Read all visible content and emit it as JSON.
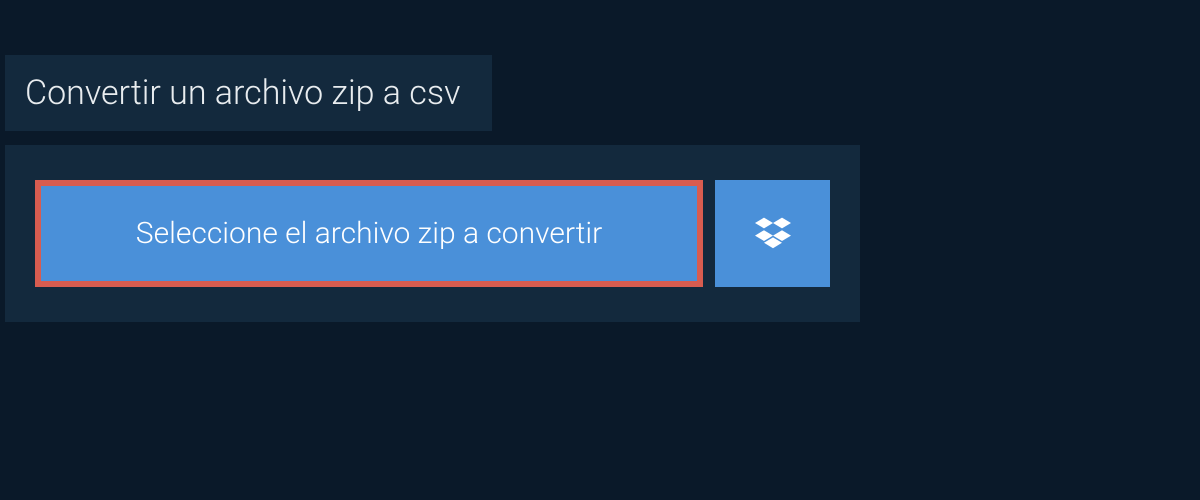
{
  "title": "Convertir un archivo zip a csv",
  "selectButton": {
    "label": "Seleccione el archivo zip a convertir"
  },
  "colors": {
    "background": "#0a1929",
    "panel": "#13293d",
    "buttonPrimary": "#4a90d9",
    "highlightBorder": "#d85c50",
    "text": "#e8ecef"
  }
}
